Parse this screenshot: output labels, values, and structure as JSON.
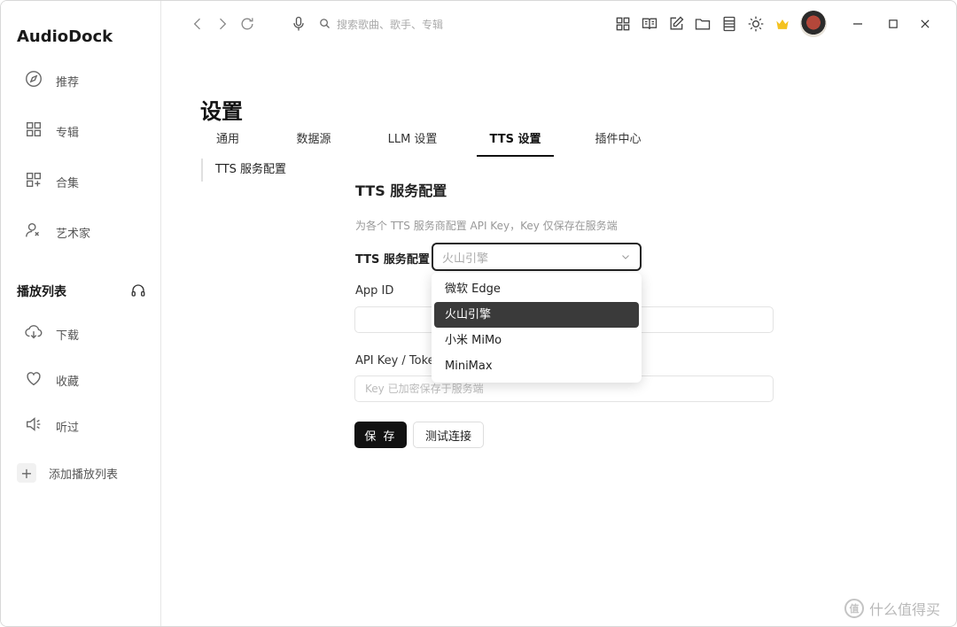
{
  "app": {
    "name": "AudioDock"
  },
  "sidebar": {
    "items": [
      {
        "label": "推荐",
        "icon": "compass-icon"
      },
      {
        "label": "专辑",
        "icon": "grid-icon"
      },
      {
        "label": "合集",
        "icon": "grid-plus-icon"
      },
      {
        "label": "艺术家",
        "icon": "artist-icon"
      }
    ],
    "playlist_title": "播放列表",
    "playlist_items": [
      {
        "label": "下载",
        "icon": "cloud-download-icon"
      },
      {
        "label": "收藏",
        "icon": "heart-icon"
      },
      {
        "label": "听过",
        "icon": "speaker-icon"
      }
    ],
    "add_playlist_label": "添加播放列表"
  },
  "topbar": {
    "search_placeholder": "搜索歌曲、歌手、专辑"
  },
  "page": {
    "title": "设置",
    "tabs": [
      "通用",
      "数据源",
      "LLM 设置",
      "TTS 设置",
      "插件中心"
    ],
    "active_tab": "TTS 设置",
    "subnav_item": "TTS 服务配置"
  },
  "tts": {
    "heading": "TTS 服务配置",
    "description": "为各个 TTS 服务商配置 API Key，Key 仅保存在服务端",
    "service_label": "TTS 服务配置",
    "selected_service": "火山引擎",
    "options": [
      "微软 Edge",
      "火山引擎",
      "小米 MiMo",
      "MiniMax"
    ],
    "app_id_label": "App ID",
    "app_id_value": "",
    "api_key_label": "API Key / Token",
    "api_key_placeholder": "Key 已加密保存于服务端",
    "save_label": "保 存",
    "test_label": "测试连接"
  },
  "watermark": {
    "text": "什么值得买",
    "badge": "值"
  }
}
